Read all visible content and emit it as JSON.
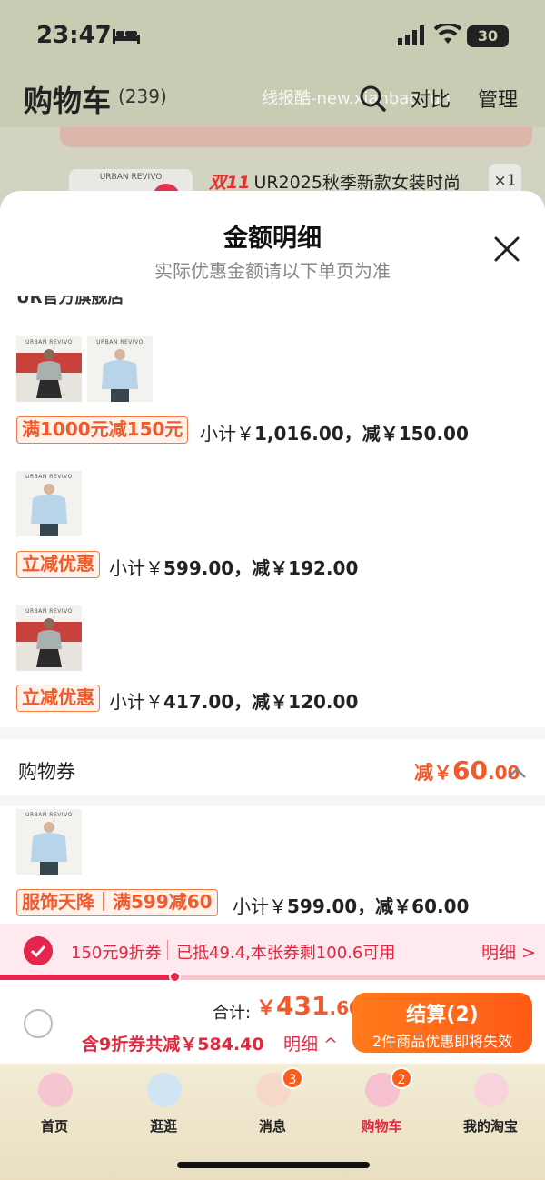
{
  "status": {
    "time": "23:47",
    "battery": "30"
  },
  "header": {
    "title": "购物车",
    "count": "(239)",
    "watermark": "线报酷-new.xianbao.fun",
    "compare": "对比",
    "manage": "管理"
  },
  "background_item": {
    "brand": "URBAN REVIVO",
    "promo_prefix": "双11",
    "title": "UR2025秋季新款女装时尚",
    "qty": "×1"
  },
  "sheet": {
    "title": "金额明细",
    "subtitle": "实际优惠金额请以下单页为准",
    "shop_name": "UR官方旗舰店"
  },
  "groups": [
    {
      "brand": "URBAN REVIVO",
      "tag": "满1000元减150元",
      "subtotal_prefix": "小计￥",
      "subtotal": "1,016.00",
      "discount": "，减￥150.00"
    },
    {
      "brand": "URBAN REVIVO",
      "tag": "立减优惠",
      "subtotal_prefix": "小计￥",
      "subtotal": "599.00",
      "discount": "，减￥192.00"
    },
    {
      "brand": "URBAN REVIVO",
      "tag": "立减优惠",
      "subtotal_prefix": "小计￥",
      "subtotal": "417.00",
      "discount": "，减￥120.00"
    }
  ],
  "coupon": {
    "label": "购物券",
    "amount_prefix": "减￥",
    "amount_int": "60",
    "amount_dec": ".00",
    "item": {
      "brand": "URBAN REVIVO",
      "tag": "服饰天降｜满599减60",
      "subtotal_prefix": "小计￥",
      "subtotal": "599.00",
      "discount": "，减￥60.00"
    }
  },
  "voucher": {
    "name": "150元9折券",
    "desc": "已抵49.4,本张券剩100.6可用",
    "detail": "明细 >",
    "used_fraction": 0.32
  },
  "checkout": {
    "total_label": "合计:",
    "currency": "￥",
    "total_int": "431",
    "total_dec": ".60",
    "saved": "含9折券共减￥584.40",
    "detail": "明细 ^",
    "pay_label": "结算(2)",
    "pay_note": "2件商品优惠即将失效"
  },
  "tabs": [
    {
      "label": "首页",
      "icon": "kitty-icon"
    },
    {
      "label": "逛逛",
      "icon": "cinnamoroll-icon"
    },
    {
      "label": "消息",
      "icon": "cake-icon",
      "badge": "3"
    },
    {
      "label": "购物车",
      "icon": "melody-icon",
      "badge": "2"
    },
    {
      "label": "我的淘宝",
      "icon": "kitty-cup-icon"
    }
  ],
  "colors": {
    "accent": "#f2592b",
    "red": "#e0283f",
    "pay": "#ff6a19"
  }
}
